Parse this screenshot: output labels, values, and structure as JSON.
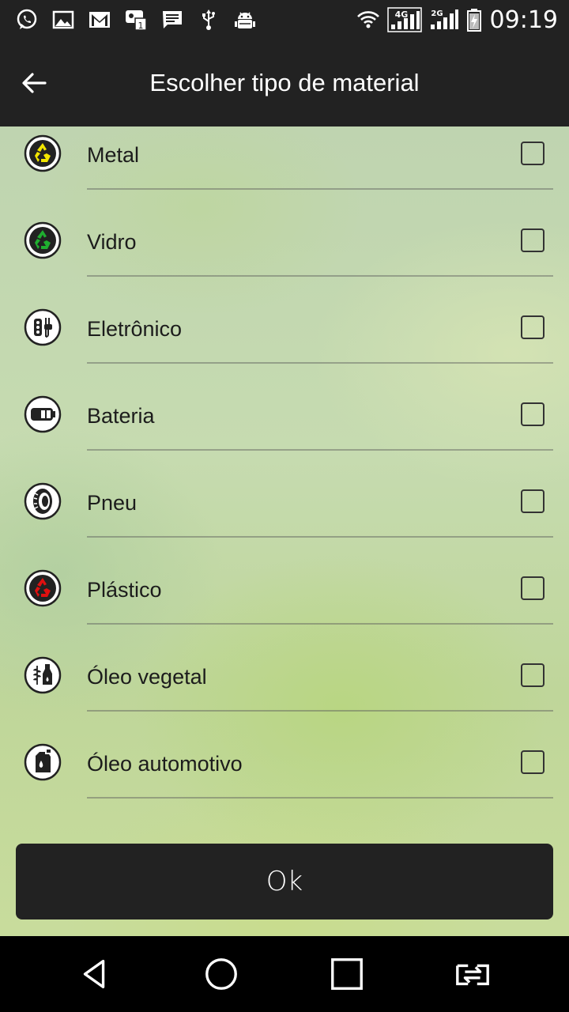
{
  "status_bar": {
    "time": "09:19",
    "left_icons": [
      "whatsapp-icon",
      "image-icon",
      "gmail-icon",
      "chat-notification-icon",
      "message-icon",
      "usb-icon",
      "android-debug-icon"
    ],
    "right_icons": [
      "wifi-icon",
      "signal-4g-icon",
      "signal-2g-icon",
      "battery-charging-icon"
    ],
    "network_4g": "4G",
    "network_2g": "2G"
  },
  "app_bar": {
    "title": "Escolher tipo de material",
    "back_icon": "arrow-back-icon"
  },
  "materials": [
    {
      "label": "Metal",
      "icon": "recycle-yellow-icon",
      "icon_color": "#f2e600",
      "checked": false
    },
    {
      "label": "Vidro",
      "icon": "recycle-green-icon",
      "icon_color": "#1a9a2a",
      "checked": false
    },
    {
      "label": "Eletrônico",
      "icon": "electronic-plug-icon",
      "icon_color": "#222222",
      "checked": false
    },
    {
      "label": "Bateria",
      "icon": "battery-icon",
      "icon_color": "#222222",
      "checked": false
    },
    {
      "label": "Pneu",
      "icon": "tire-icon",
      "icon_color": "#222222",
      "checked": false
    },
    {
      "label": "Plástico",
      "icon": "recycle-red-icon",
      "icon_color": "#e01010",
      "checked": false
    },
    {
      "label": "Óleo vegetal",
      "icon": "vegetable-oil-icon",
      "icon_color": "#222222",
      "checked": false
    },
    {
      "label": "Óleo automotivo",
      "icon": "motor-oil-icon",
      "icon_color": "#222222",
      "checked": false
    }
  ],
  "ok_button": {
    "label": "Ok"
  },
  "nav_bar": {
    "buttons": [
      "back-triangle-icon",
      "home-circle-icon",
      "recents-square-icon",
      "switch-app-icon"
    ]
  },
  "colors": {
    "bar_background": "#222222",
    "text_dark": "#1c1c1c"
  }
}
